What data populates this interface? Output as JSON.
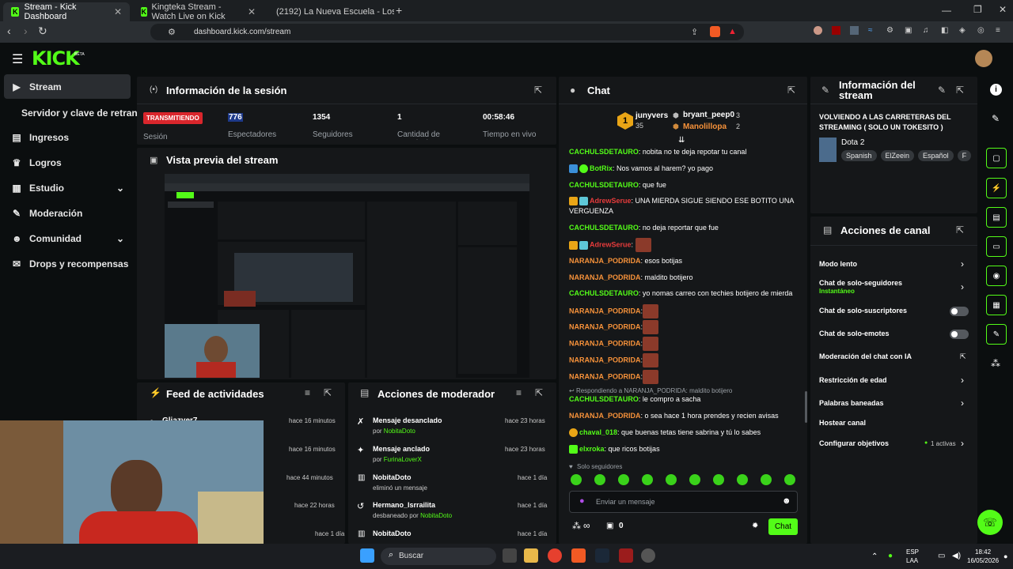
{
  "browser": {
    "tabs": [
      {
        "label": "Stream - Kick Dashboard",
        "favicon": "kick-icon",
        "active": true
      },
      {
        "label": "Kingteka Stream - Watch Live on Kick",
        "favicon": "kick-icon",
        "active": false
      },
      {
        "label": "(2192) La Nueva Escuela - Los Mayor",
        "favicon": "youtube-icon",
        "active": false
      }
    ],
    "url": "dashboard.kick.com/stream"
  },
  "header": {
    "logo": "KICK",
    "logo_badge": "BETA"
  },
  "sidebar": {
    "items": [
      {
        "label": "Stream",
        "icon": "play-icon",
        "active": true
      },
      {
        "label": "Servidor y clave de retransmisión",
        "icon": "",
        "active": false
      },
      {
        "label": "Ingresos",
        "icon": "chart-icon"
      },
      {
        "label": "Logros",
        "icon": "trophy-icon"
      },
      {
        "label": "Estudio",
        "icon": "studio-icon",
        "expand": "⌄"
      },
      {
        "label": "Moderación",
        "icon": "wrench-icon"
      },
      {
        "label": "Comunidad",
        "icon": "people-icon",
        "expand": "⌄"
      },
      {
        "label": "Drops y recompensas",
        "icon": "gift-icon"
      }
    ]
  },
  "session": {
    "title": "Información de la sesión",
    "status_badge": "TRANSMITIENDO",
    "status_label": "Sesión",
    "stats": [
      {
        "value": "776",
        "label": "Espectadores"
      },
      {
        "value": "1354",
        "label": "Seguidores"
      },
      {
        "value": "1",
        "label": "Cantidad de suscripciones"
      },
      {
        "value": "00:58:46",
        "label": "Tiempo en vivo"
      }
    ]
  },
  "preview": {
    "title": "Vista previa del stream"
  },
  "feed": {
    "title": "Feed de actividades",
    "items": [
      {
        "name": "Gliazyer7",
        "time": "hace 16 minutos"
      },
      {
        "name": "",
        "time": "hace 16 minutos"
      },
      {
        "name": "",
        "time": "hace 44 minutos"
      },
      {
        "name": "",
        "time": "hace 22 horas"
      },
      {
        "name": "",
        "time": "hace 1 día"
      }
    ]
  },
  "mod_actions": {
    "title": "Acciones de moderador",
    "items": [
      {
        "title": "Mensaje desanclado",
        "prefix": "por ",
        "who": "NobitaDoto",
        "time": "hace 23 horas",
        "icon": "unpin-icon"
      },
      {
        "title": "Mensaje anclado",
        "prefix": "por ",
        "who": "FurinaLoverX",
        "time": "hace 23 horas",
        "icon": "pin-icon"
      },
      {
        "title": "NobitaDoto",
        "prefix": "",
        "who": "eliminó un mensaje",
        "time": "hace 1 día",
        "icon": "trash-icon"
      },
      {
        "title": "Hermano_Isrrailita",
        "prefix": "desbaneado por ",
        "who": "NobitaDoto",
        "time": "hace 1 día",
        "icon": "undo-icon"
      },
      {
        "title": "NobitaDoto",
        "prefix": "",
        "who": "",
        "time": "hace 1 día",
        "icon": "trash-icon"
      }
    ]
  },
  "chat": {
    "title": "Chat",
    "leaderboard": {
      "rank": "1",
      "first_name": "junyvers",
      "first_count": "35",
      "second_name": "bryant_peep0",
      "second_count": "3",
      "third_name": "Manolillopa",
      "third_count": "2"
    },
    "messages": [
      {
        "user": "CACHULSDETAURO",
        "color": "#53fc18",
        "text": ": nobita no te deja repotar tu canal"
      },
      {
        "user": "BotRix",
        "color": "#53fc18",
        "text": ": Nos vamos al harem? yo pago"
      },
      {
        "user": "CACHULSDETAURO",
        "color": "#53fc18",
        "text": ": que fue"
      },
      {
        "user": "AdrewSerue",
        "color": "#e63b3b",
        "text": ": UNA MIERDA SIGUE SIENDO ESE BOTITO UNA VERGUENZA"
      },
      {
        "user": "CACHULSDETAURO",
        "color": "#53fc18",
        "text": ": no deja reportar que fue"
      },
      {
        "user": "AdrewSerue",
        "color": "#e63b3b",
        "text": ":"
      },
      {
        "user": "NARANJA_PODRIDA",
        "color": "#f7923a",
        "text": ": esos botijas"
      },
      {
        "user": "NARANJA_PODRIDA",
        "color": "#f7923a",
        "text": ": maldito botijero"
      },
      {
        "user": "CACHULSDETAURO",
        "color": "#53fc18",
        "text": ": yo nomas carreo con techies botijero de mierda"
      },
      {
        "user": "NARANJA_PODRIDA",
        "color": "#f7923a",
        "text": ":"
      },
      {
        "user": "NARANJA_PODRIDA",
        "color": "#f7923a",
        "text": ":"
      },
      {
        "user": "NARANJA_PODRIDA",
        "color": "#f7923a",
        "text": ":"
      },
      {
        "user": "NARANJA_PODRIDA",
        "color": "#f7923a",
        "text": ":"
      },
      {
        "user": "NARANJA_PODRIDA",
        "color": "#f7923a",
        "text": ":"
      }
    ],
    "reply_to": "Respondiendo a NARANJA_PODRIDA: maldito botijero",
    "messages2": [
      {
        "user": "CACHULSDETAURO",
        "color": "#53fc18",
        "text": ": le compro a sacha"
      },
      {
        "user": "NARANJA_PODRIDA",
        "color": "#f7923a",
        "text": ": o sea hace 1 hora prendes y recien avisas"
      },
      {
        "user": "chaval_018",
        "color": "#53fc18",
        "text": ": que buenas tetas tiene sabrina y tú lo sabes"
      },
      {
        "user": "elxroka",
        "color": "#53fc18",
        "text": ": que ricos botijas"
      }
    ],
    "followers_only": "Solo seguidores",
    "input_placeholder": "Enviar un mensaje",
    "points": "∞",
    "count": "0",
    "send_label": "Chat"
  },
  "stream_info": {
    "title": "Información del stream",
    "stream_title": "VOLVIENDO A LAS CARRETERAS DEL STREAMING ( SOLO UN TOKESITO )",
    "category": "Dota 2",
    "tags": [
      "Spanish",
      "ElZeein",
      "Español",
      "F"
    ]
  },
  "channel_actions": {
    "title": "Acciones de canal",
    "items": [
      {
        "label": "Modo lento",
        "sub": "",
        "control": "chevron"
      },
      {
        "label": "Chat de solo-seguidores",
        "sub": "Instantáneo",
        "control": "chevron"
      },
      {
        "label": "Chat de solo-suscriptores",
        "sub": "",
        "control": "toggle"
      },
      {
        "label": "Chat de solo-emotes",
        "sub": "",
        "control": "toggle"
      },
      {
        "label": "Moderación del chat con IA",
        "sub": "",
        "control": "external"
      },
      {
        "label": "Restricción de edad",
        "sub": "",
        "control": "chevron"
      },
      {
        "label": "Palabras baneadas",
        "sub": "",
        "control": "chevron"
      },
      {
        "label": "Hostear canal",
        "sub": "",
        "control": "none"
      },
      {
        "label": "Configurar objetivos",
        "sub": "1 activas",
        "control": "chevron"
      }
    ]
  },
  "taskbar": {
    "search_placeholder": "Buscar",
    "lang": "ESP",
    "lang2": "LAA",
    "time": "18:42",
    "date": "16/05/2026"
  },
  "colors": {
    "accent": "#53fc18",
    "live": "#d9262c",
    "panel": "#151719",
    "bg": "#0b0e0f"
  }
}
